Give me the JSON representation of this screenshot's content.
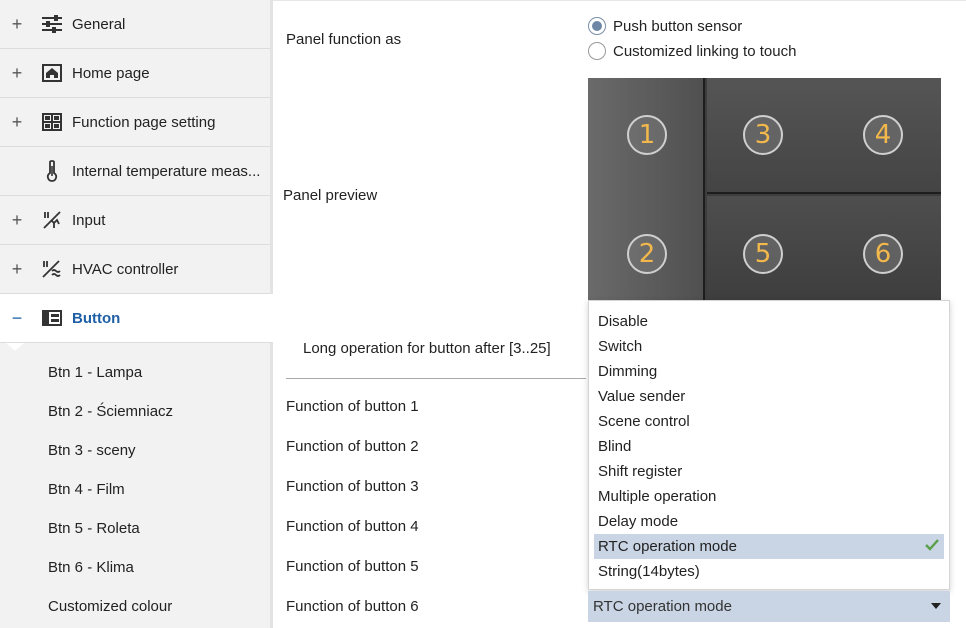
{
  "sidebar": {
    "items": [
      {
        "label": "General",
        "expander": "+",
        "icon": "sliders-icon"
      },
      {
        "label": "Home page",
        "expander": "+",
        "icon": "home-icon"
      },
      {
        "label": "Function page setting",
        "expander": "+",
        "icon": "grid-icon"
      },
      {
        "label": "Internal temperature meas...",
        "expander": "",
        "icon": "thermometer-icon"
      },
      {
        "label": "Input",
        "expander": "+",
        "icon": "input-icon"
      },
      {
        "label": "HVAC controller",
        "expander": "+",
        "icon": "hvac-icon"
      },
      {
        "label": "Button",
        "expander": "−",
        "icon": "button-layout-icon"
      }
    ],
    "subitems": [
      "Btn 1 - Lampa",
      "Btn 2 - Ściemniacz",
      "Btn 3 - sceny",
      "Btn 4 - Film",
      "Btn 5 - Roleta",
      "Btn 6 - Klima",
      "Customized colour"
    ]
  },
  "main": {
    "panel_function_label": "Panel function as",
    "radio_options": [
      {
        "label": "Push button sensor",
        "checked": true
      },
      {
        "label": "Customized linking to touch",
        "checked": false
      }
    ],
    "panel_preview_label": "Panel preview",
    "preview_buttons": [
      "1",
      "2",
      "3",
      "4",
      "5",
      "6"
    ],
    "long_operation_label": "Long operation for button after [3..25]",
    "function_rows": [
      "Function of button 1",
      "Function of button 2",
      "Function of button 3",
      "Function of button 4",
      "Function of button 5",
      "Function of button 6"
    ],
    "dropdown_options": [
      "Disable",
      "Switch",
      "Dimming",
      "Value sender",
      "Scene control",
      "Blind",
      "Shift register",
      "Multiple operation",
      "Delay mode",
      "RTC operation mode",
      "String(14bytes)"
    ],
    "selected_option": "RTC operation mode",
    "select_value": "RTC operation mode"
  },
  "colors": {
    "accent": "#1f5fa6",
    "selection": "#c9d5e4",
    "check": "#5aa04a",
    "preview_number": "#f2b84b"
  }
}
